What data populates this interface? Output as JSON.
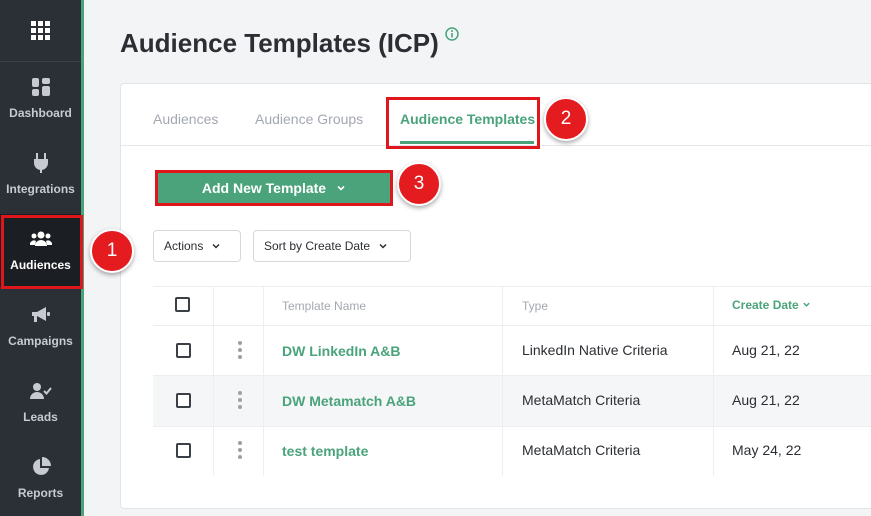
{
  "sidebar": {
    "items": [
      {
        "label": "Dashboard",
        "icon": "dashboard-icon"
      },
      {
        "label": "Integrations",
        "icon": "plug-icon"
      },
      {
        "label": "Audiences",
        "icon": "users-icon"
      },
      {
        "label": "Campaigns",
        "icon": "megaphone-icon"
      },
      {
        "label": "Leads",
        "icon": "user-check-icon"
      },
      {
        "label": "Reports",
        "icon": "pie-chart-icon"
      }
    ]
  },
  "header": {
    "title": "Audience Templates (ICP)"
  },
  "tabs": [
    {
      "label": "Audiences"
    },
    {
      "label": "Audience Groups"
    },
    {
      "label": "Audience Templates"
    }
  ],
  "toolbar": {
    "add_label": "Add New Template",
    "actions_label": "Actions",
    "sort_label": "Sort by Create Date"
  },
  "table": {
    "columns": [
      "Template Name",
      "Type",
      "Create Date"
    ],
    "rows": [
      {
        "name": "DW LinkedIn A&B",
        "type": "LinkedIn Native Criteria",
        "date": "Aug 21, 22"
      },
      {
        "name": "DW Metamatch A&B",
        "type": "MetaMatch Criteria",
        "date": "Aug 21, 22"
      },
      {
        "name": "test template",
        "type": "MetaMatch Criteria",
        "date": "May 24, 22"
      }
    ]
  },
  "badges": [
    "1",
    "2",
    "3"
  ],
  "colors": {
    "accent": "#4aa37b",
    "highlight": "#e0161d",
    "sidebar": "#2b2f36"
  }
}
